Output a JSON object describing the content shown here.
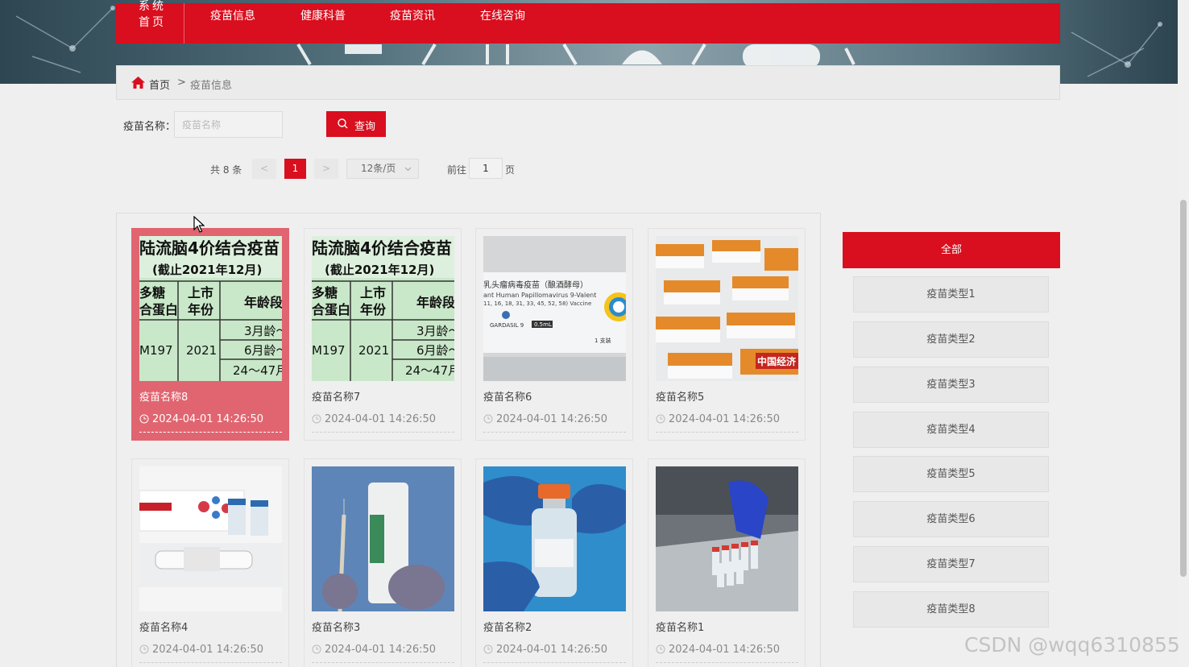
{
  "nav": {
    "brand": "系统首页",
    "items": [
      "疫苗信息",
      "健康科普",
      "疫苗资讯",
      "在线咨询"
    ]
  },
  "breadcrumb": {
    "home": "首页",
    "separator": ">",
    "current": "疫苗信息"
  },
  "search": {
    "label": "疫苗名称：",
    "placeholder": "疫苗名称",
    "button": "查询"
  },
  "pager": {
    "total": "共 8 条",
    "prev": "<",
    "current": "1",
    "next": ">",
    "page_size": "12条/页",
    "goto_label": "前往",
    "goto_value": "1",
    "page_suffix": "页"
  },
  "vaccines": [
    {
      "name": "疫苗名称8",
      "date": "2024-04-01 14:26:50",
      "image": "chart-table-image",
      "active": true
    },
    {
      "name": "疫苗名称7",
      "date": "2024-04-01 14:26:50",
      "image": "chart-table-image",
      "active": false
    },
    {
      "name": "疫苗名称6",
      "date": "2024-04-01 14:26:50",
      "image": "vaccine-box-image",
      "active": false
    },
    {
      "name": "疫苗名称5",
      "date": "2024-04-01 14:26:50",
      "image": "vaccine-stack-image",
      "active": false
    },
    {
      "name": "疫苗名称4",
      "date": "2024-04-01 14:26:50",
      "image": "vial-kit-image",
      "active": false
    },
    {
      "name": "疫苗名称3",
      "date": "2024-04-01 14:26:50",
      "image": "syringe-box-image",
      "active": false
    },
    {
      "name": "疫苗名称2",
      "date": "2024-04-01 14:26:50",
      "image": "hand-vial-image",
      "active": false
    },
    {
      "name": "疫苗名称1",
      "date": "2024-04-01 14:26:50",
      "image": "production-line-image",
      "active": false
    }
  ],
  "image_text": {
    "table_title": "陆流脑4价结合疫苗",
    "table_subtitle": "(截止2021年12月)",
    "table_h1": "多糖",
    "table_h1b": "合蛋白",
    "table_h2": "上市",
    "table_h2b": "年份",
    "table_h3": "年龄段",
    "table_c1": "M197",
    "table_c2": "2021",
    "table_r1": "3月龄～",
    "table_r2": "6月龄～",
    "table_r3": "24～47月",
    "box_line1": "乳头瘤病毒疫苗（酿酒酵母）",
    "box_line2": "ant Human Papillomavirus 9-Valent",
    "box_line3": "11, 16, 18, 31, 33, 45, 52, 58) Vaccine",
    "box_brand": "GARDASIL 9",
    "box_dose": "0.5mL",
    "box_count": "1 支装",
    "stack_mark": "中国经济"
  },
  "categories": {
    "all": "全部",
    "items": [
      "疫苗类型1",
      "疫苗类型2",
      "疫苗类型3",
      "疫苗类型4",
      "疫苗类型5",
      "疫苗类型6",
      "疫苗类型7",
      "疫苗类型8"
    ]
  },
  "watermark": "CSDN @wqq6310855",
  "colors": {
    "primary": "#d90e1e",
    "active_card": "#e06570",
    "background": "#efefef"
  }
}
